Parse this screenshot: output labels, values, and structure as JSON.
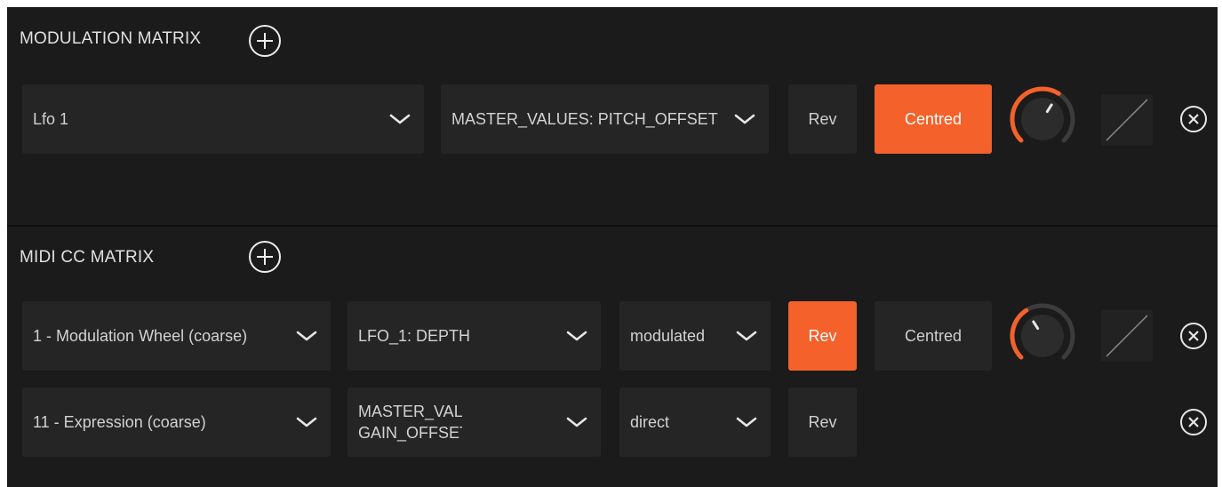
{
  "colors": {
    "panel": "#1b1b1b",
    "control": "#252525",
    "accent": "#f4612b",
    "text": "#d2d2d2"
  },
  "modulation_matrix": {
    "title": "MODULATION MATRIX",
    "add_icon": "plus-circle-icon",
    "rows": [
      {
        "source": "Lfo 1",
        "destination": "MASTER_VALUES: PITCH_OFFSET",
        "rev_label": "Rev",
        "rev_active": false,
        "centred_label": "Centred",
        "centred_active": true,
        "amount": 0.62,
        "curve_icon": "linear-curve-icon",
        "remove_icon": "close-circle-icon"
      }
    ]
  },
  "midi_cc_matrix": {
    "title": "MIDI CC MATRIX",
    "add_icon": "plus-circle-icon",
    "rows": [
      {
        "source": "1 - Modulation Wheel (coarse)",
        "destination": "LFO_1: DEPTH",
        "mode": "modulated",
        "rev_label": "Rev",
        "rev_active": true,
        "centred_label": "Centred",
        "centred_active": false,
        "amount": 0.38,
        "curve_icon": "linear-curve-icon",
        "remove_icon": "close-circle-icon"
      },
      {
        "source": "11 - Expression (coarse)",
        "destination": "MASTER_VALUES: GAIN_OFFSET",
        "mode": "direct",
        "rev_label": "Rev",
        "rev_active": false,
        "remove_icon": "close-circle-icon"
      }
    ]
  }
}
